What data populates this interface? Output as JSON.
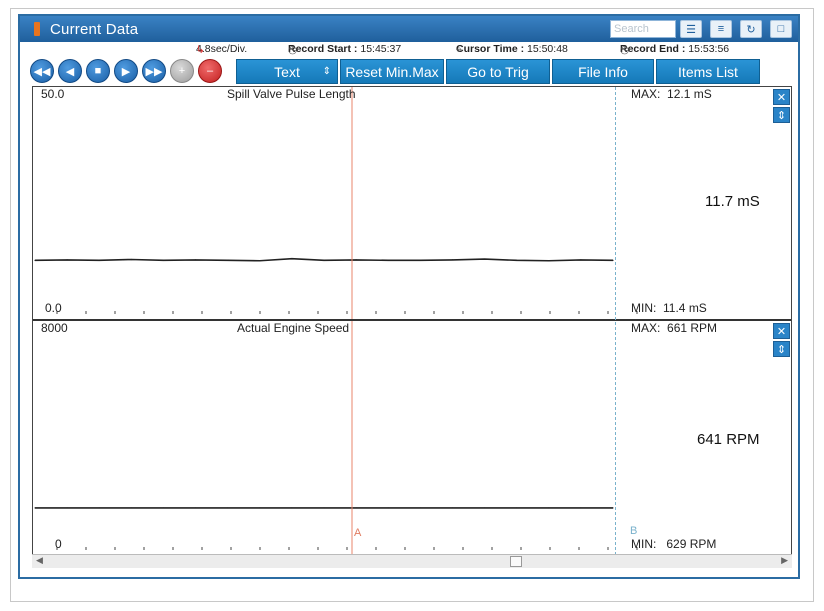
{
  "window": {
    "title": "Current Data",
    "search_placeholder": "Search"
  },
  "info": {
    "time_div": "4.8sec/Div.",
    "record_start_label": "Record Start :",
    "record_start": "15:45:37",
    "cursor_time_label": "Cursor Time :",
    "cursor_time": "15:50:48",
    "record_end_label": "Record End :",
    "record_end": "15:53:56"
  },
  "toolbar": {
    "text_label": "Text",
    "reset_label": "Reset Min.Max",
    "goto_trig_label": "Go to Trig",
    "file_info_label": "File Info",
    "items_list_label": "Items List"
  },
  "graph1": {
    "title": "Spill Valve Pulse Length",
    "ymax": "50.0",
    "ymin": "0.0",
    "max_label": "MAX:",
    "max_value": "12.1 mS",
    "current_value": "11.7 mS",
    "min_label": "MIN:",
    "min_value": "11.4 mS"
  },
  "graph2": {
    "title": "Actual Engine Speed",
    "ymax": "8000",
    "ymin": "0",
    "max_label": "MAX:",
    "max_value": "661 RPM",
    "current_value": "641 RPM",
    "min_label": "MIN:",
    "min_value": "629 RPM"
  },
  "cursor": {
    "a_label": "A",
    "b_label": "B"
  },
  "chart_data": [
    {
      "type": "line",
      "title": "Spill Valve Pulse Length",
      "ylim": [
        0,
        50
      ],
      "series": [
        {
          "values": [
            11.7,
            11.8,
            11.7,
            11.9,
            11.7,
            11.8,
            11.7,
            11.6,
            12.1,
            11.7,
            11.8,
            11.7,
            11.7,
            11.8,
            12.0,
            11.7,
            11.6,
            11.8,
            11.7
          ]
        }
      ]
    },
    {
      "type": "line",
      "title": "Actual Engine Speed",
      "ylim": [
        0,
        8000
      ],
      "series": [
        {
          "values": [
            641,
            640,
            642,
            641,
            641,
            640,
            642,
            641,
            641,
            640,
            641,
            642,
            641,
            641,
            640,
            641,
            642,
            641,
            641
          ]
        }
      ]
    }
  ]
}
